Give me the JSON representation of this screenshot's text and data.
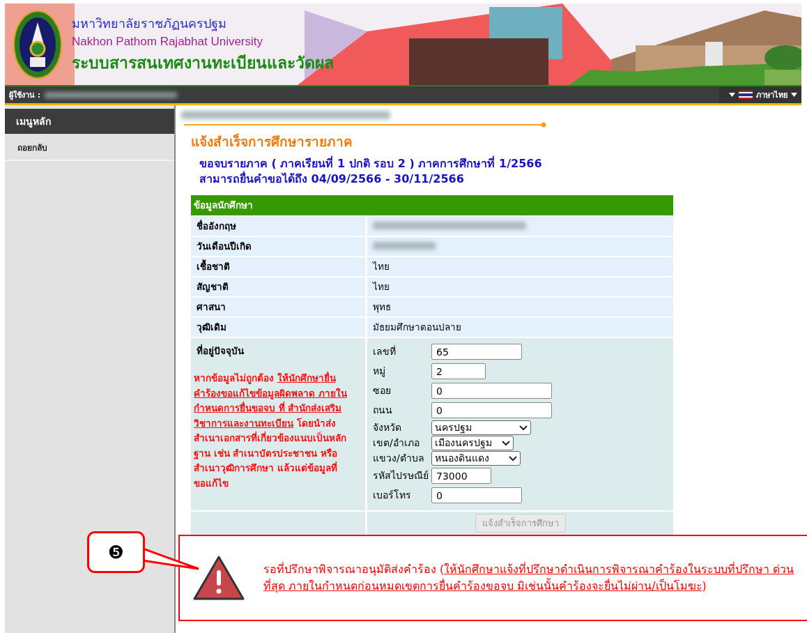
{
  "header": {
    "title_th": "มหาวิทยาลัยราชภัฏนครปฐม",
    "title_en": "Nakhon Pathom Rajabhat University",
    "system_name": "ระบบสารสนเทศงานทะเบียนและวัดผล"
  },
  "user_bar": {
    "user_label": "ผู้ใช้งาน :",
    "language": "ภาษาไทย"
  },
  "sidebar": {
    "title": "เมนูหลัก",
    "items": [
      {
        "label": "ถอยกลับ"
      }
    ]
  },
  "page": {
    "title": "แจ้งสำเร็จการศึกษารายภาค",
    "subtitle_lines": [
      "ขอจบรายภาค ( ภาคเรียนที่ 1 ปกติ รอบ 2 ) ภาคการศึกษาที่ 1/2566",
      "สามารถยื่นคำขอได้ถึง 04/09/2566 - 30/11/2566"
    ]
  },
  "student_table": {
    "title": "ข้อมูลนักศึกษา",
    "rows": [
      {
        "label": "ชื่ออังกฤษ",
        "kind": "redacted"
      },
      {
        "label": "วันเดือนปีเกิด",
        "kind": "redacted"
      },
      {
        "label": "เชื้อชาติ",
        "kind": "text",
        "value": "ไทย"
      },
      {
        "label": "สัญชาติ",
        "kind": "text",
        "value": "ไทย"
      },
      {
        "label": "ศาสนา",
        "kind": "text",
        "value": "พุทธ"
      },
      {
        "label": "วุฒิเดิม",
        "kind": "text",
        "value": "มัธยมศึกษาตอนปลาย"
      }
    ]
  },
  "address": {
    "label": "ที่อยู่ปัจจุบัน",
    "warning": {
      "lead": "หากข้อมูลไม่ถูกต้อง ",
      "underlined": "ให้นักศึกษายื่นคำร้องขอแก้ไขข้อมูลผิดพลาด ภายในกำหนดการยื่นขอจบ ที่ สำนักส่งเสริมวิชาการและงานทะเบียน",
      "rest": " โดยนำส่งสำเนาเอกสารที่เกี่ยวข้องแนบเป็นหลักฐาน เช่น สำเนาบัตรประชาชน หรือสำเนาวุฒิการศึกษา แล้วแต่ข้อมูลที่ขอแก้ไข"
    },
    "fields": [
      {
        "label": "เลขที่",
        "kind": "text",
        "value": "65"
      },
      {
        "label": "หมู่",
        "kind": "text",
        "value": "2"
      },
      {
        "label": "ซอย",
        "kind": "text",
        "value": "0"
      },
      {
        "label": "ถนน",
        "kind": "text",
        "value": "0"
      },
      {
        "label": "จังหวัด",
        "kind": "select",
        "value": "นครปฐม"
      },
      {
        "label": "เขต/อำเภอ",
        "kind": "select",
        "value": "เมืองนครปฐม"
      },
      {
        "label": "แขวง/ตำบล",
        "kind": "select",
        "value": "หนองดินแดง"
      },
      {
        "label": "รหัสไปรษณีย์",
        "kind": "text",
        "value": "73000"
      },
      {
        "label": "เบอร์โทร",
        "kind": "text",
        "value": "0"
      }
    ]
  },
  "submit_button": {
    "label": "แจ้งสำเร็จการศึกษา",
    "disabled": true
  },
  "notice": {
    "lead": "รอที่ปรึกษาพิจารณาอนุมัติส่งคำร้อง (",
    "underlined": "ให้นักศึกษาแจ้งที่ปรึกษาดำเนินการพิจารณาคำร้องในระบบที่ปรึกษา ด่วนที่สุด ภายในกำหนดก่อนหมดเขตการยื่นคำร้องขอจบ มิเช่นนั้นคำร้องจะยื่นไม่ผ่าน/เป็นโมฆะ",
    "tail": ")"
  },
  "callout": {
    "label": "❺"
  }
}
